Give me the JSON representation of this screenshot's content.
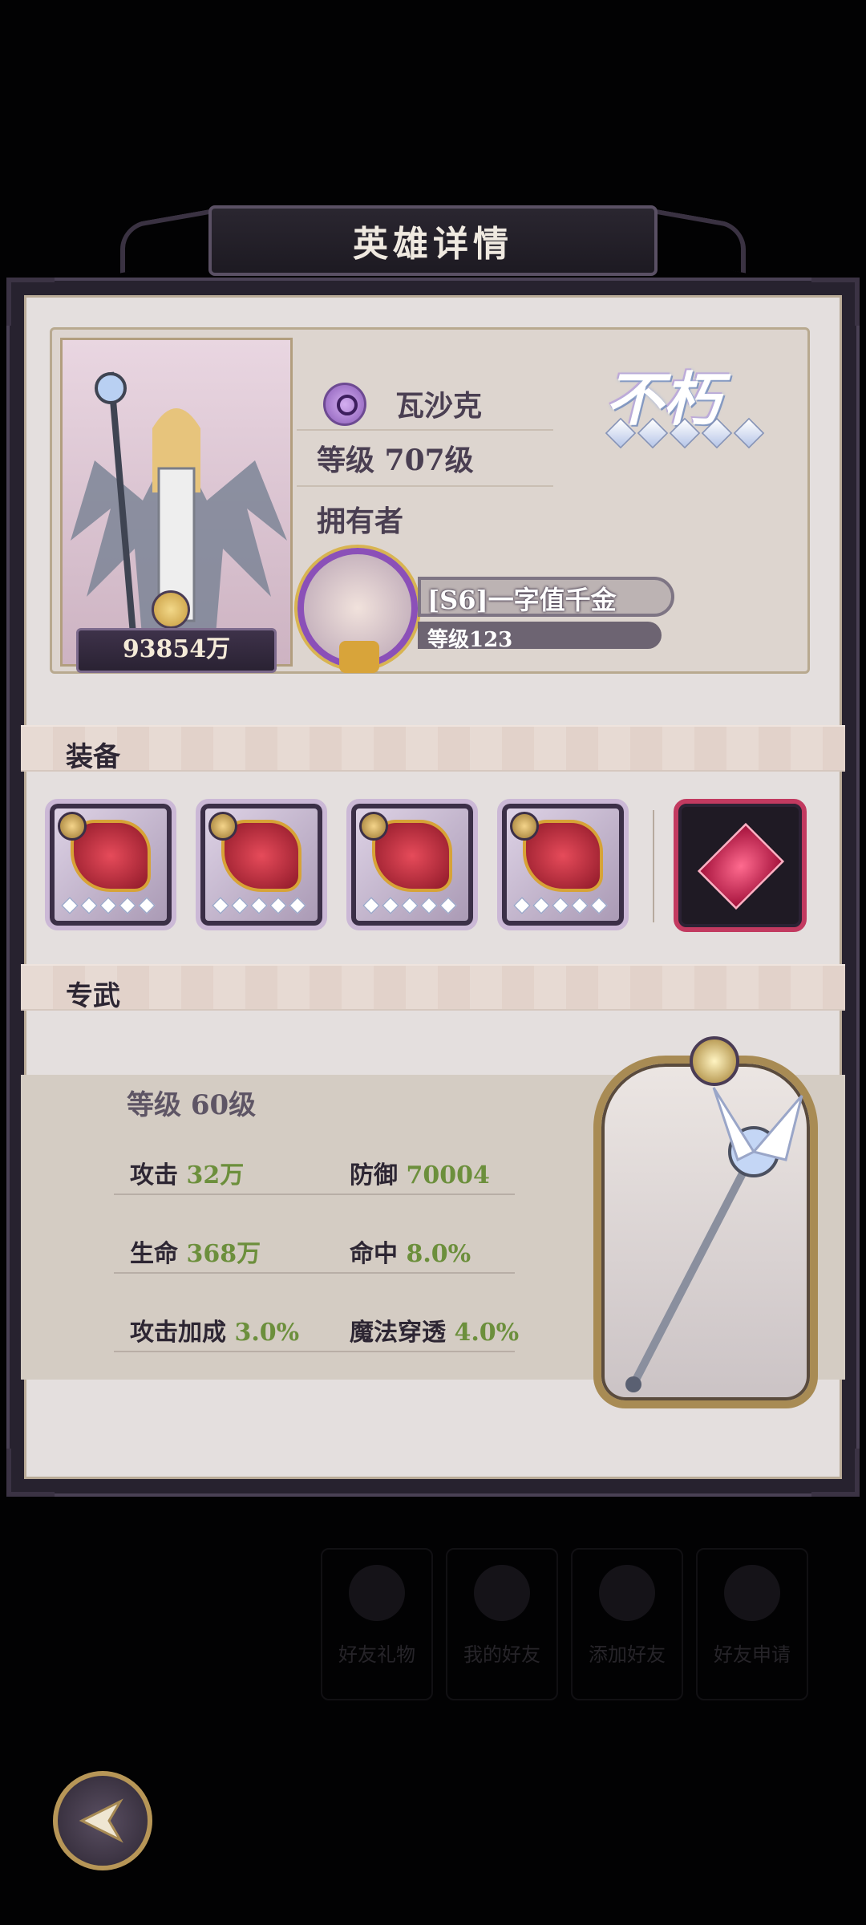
{
  "dialog": {
    "title": "英雄详情"
  },
  "hero": {
    "name": "瓦沙克",
    "power": "93854万",
    "level_text": "等级 707级",
    "owner_label": "拥有者",
    "rank_title": "不朽",
    "rank_stars": 5,
    "class_icon": "mage-orb-icon"
  },
  "owner": {
    "name": "[S6]一字值千金",
    "level": "等级123"
  },
  "equipment": {
    "section_title": "装备",
    "items": [
      {
        "name": "equipment-weapon",
        "stars": 5
      },
      {
        "name": "equipment-helmet",
        "stars": 5
      },
      {
        "name": "equipment-armor",
        "stars": 5
      },
      {
        "name": "equipment-boots",
        "stars": 5
      }
    ],
    "gem": "red-gem-icon"
  },
  "exclusive_weapon": {
    "section_title": "专武",
    "level": "等级 60级",
    "stats": [
      {
        "label": "攻击",
        "value": "32万"
      },
      {
        "label": "防御",
        "value": "70004"
      },
      {
        "label": "生命",
        "value": "368万"
      },
      {
        "label": "命中",
        "value": "8.0%"
      },
      {
        "label": "攻击加成",
        "value": "3.0%"
      },
      {
        "label": "魔法穿透",
        "value": "4.0%"
      }
    ]
  },
  "background_tabs": [
    "好友礼物",
    "我的好友",
    "添加好友",
    "好友申请"
  ],
  "colors": {
    "panel": "#e4dfde",
    "frame": "#27222f",
    "stat_value": "#6c8f3c",
    "accent_purple": "#8b50b8"
  }
}
